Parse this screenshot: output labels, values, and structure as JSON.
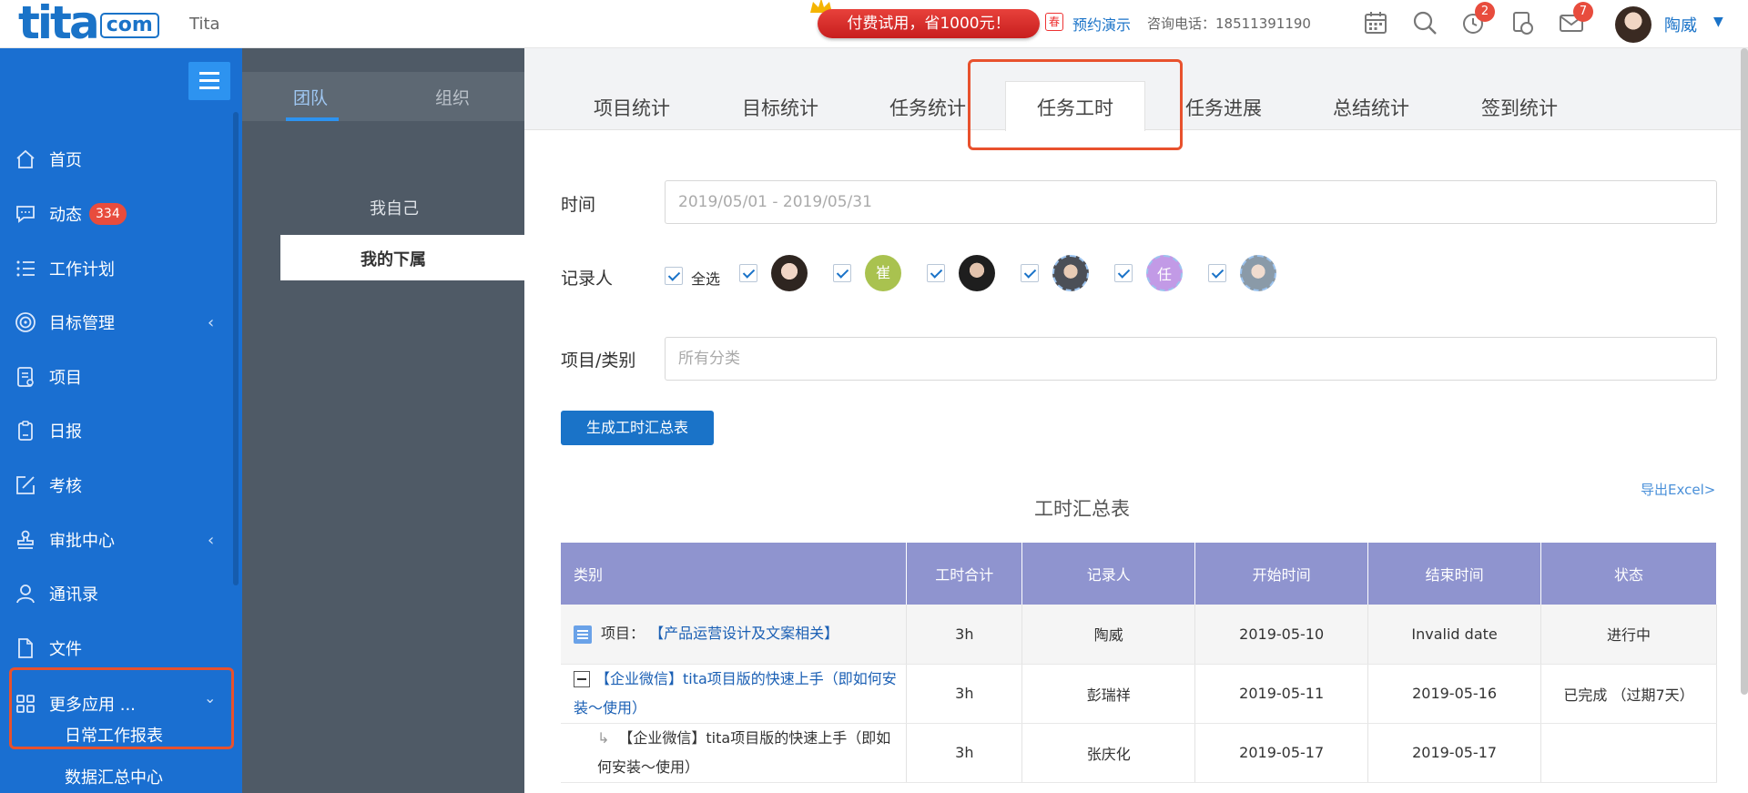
{
  "header": {
    "logo_main": "tita",
    "logo_suffix": "com",
    "app_name": "Tita",
    "promo_text": "付费试用，省1000元！",
    "spring_badge": "春",
    "demo_link": "预约演示",
    "hotline": "咨询电话：18511391190",
    "alarm_badge": "2",
    "mail_badge": "7",
    "user_name": "陶威",
    "caret": "▼"
  },
  "sidebar": {
    "items": [
      {
        "label": "首页",
        "icon": "home-icon"
      },
      {
        "label": "动态",
        "icon": "chat-icon",
        "badge": "334"
      },
      {
        "label": "工作计划",
        "icon": "list-icon"
      },
      {
        "label": "目标管理",
        "icon": "target-icon",
        "chevron": "‹"
      },
      {
        "label": "项目",
        "icon": "project-icon"
      },
      {
        "label": "日报",
        "icon": "clipboard-icon"
      },
      {
        "label": "考核",
        "icon": "edit-icon"
      },
      {
        "label": "审批中心",
        "icon": "stamp-icon",
        "chevron": "‹"
      },
      {
        "label": "通讯录",
        "icon": "person-icon"
      },
      {
        "label": "文件",
        "icon": "file-icon"
      }
    ],
    "more_apps": {
      "label": "更多应用 ...",
      "chevron": "⌄"
    },
    "sub_items": [
      "日常工作报表",
      "数据汇总中心"
    ]
  },
  "panel2": {
    "tabs": [
      "团队",
      "组织"
    ],
    "items": [
      "我自己",
      "我的下属"
    ]
  },
  "tabs": [
    "项目统计",
    "目标统计",
    "任务统计",
    "任务工时",
    "任务进展",
    "总结统计",
    "签到统计"
  ],
  "form": {
    "time_label": "时间",
    "time_placeholder": "2019/05/01 - 2019/05/31",
    "recorder_label": "记录人",
    "select_all": "全选",
    "recorder_initials": [
      "崔",
      "任"
    ],
    "category_label": "项目/类别",
    "category_placeholder": "所有分类",
    "generate_button": "生成工时汇总表"
  },
  "export_link": "导出Excel>",
  "table_title": "工时汇总表",
  "table": {
    "headers": [
      "类别",
      "工时合计",
      "记录人",
      "开始时间",
      "结束时间",
      "状态"
    ],
    "rows": [
      {
        "prefix": "项目：",
        "category": "【产品运营设计及文案相关】",
        "hours": "3h",
        "recorder": "陶威",
        "start": "2019-05-10",
        "end": "Invalid date",
        "status": "进行中"
      },
      {
        "category": "【企业微信】tita项目版的快速上手（即如何安装～使用）",
        "hours": "3h",
        "recorder": "彭瑞祥",
        "start": "2019-05-11",
        "end": "2019-05-16",
        "status": "已完成 （过期7天）"
      },
      {
        "category": "【企业微信】tita项目版的快速上手（即如何安装～使用）",
        "hours": "3h",
        "recorder": "张庆化",
        "start": "2019-05-17",
        "end": "2019-05-17",
        "status": ""
      }
    ]
  },
  "colors": {
    "sidebar_bg": "#1a6fd1",
    "panel2_bg": "#4f5a66",
    "table_header": "#8f94cf",
    "accent": "#1a73c8",
    "highlight_border": "#e8512d",
    "badge_red": "#e84c3d"
  }
}
